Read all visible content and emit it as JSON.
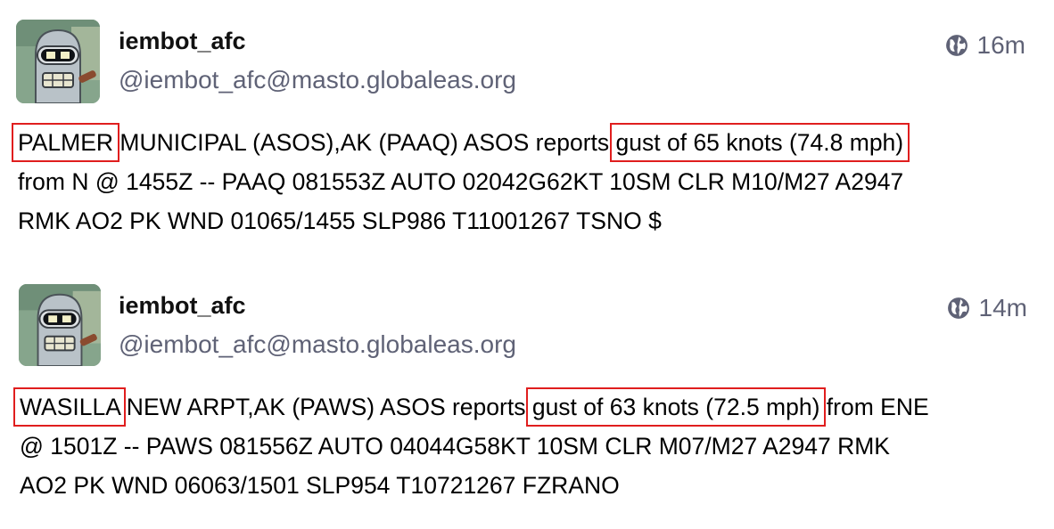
{
  "posts": [
    {
      "display_name": "iembot_afc",
      "handle": "@iembot_afc@masto.globaleas.org",
      "visibility_icon": "globe-icon",
      "timestamp": "16m",
      "content": {
        "line1_hl_station": "PALMER",
        "line1_mid": " MUNICIPAL (ASOS),AK (PAAQ) ASOS reports ",
        "line1_hl_gust": "gust of 65 knots (74.8 mph)",
        "line2": "from N @ 1455Z -- PAAQ 081553Z AUTO 02042G62KT 10SM CLR M10/M27 A2947",
        "line3": "RMK AO2 PK WND 01065/1455 SLP986 T11001267 TSNO $"
      }
    },
    {
      "display_name": "iembot_afc",
      "handle": "@iembot_afc@masto.globaleas.org",
      "visibility_icon": "globe-icon",
      "timestamp": "14m",
      "content": {
        "line1_hl_station": "WASILLA",
        "line1_mid": " NEW ARPT,AK (PAWS) ASOS reports ",
        "line1_hl_gust": "gust of 63 knots (72.5 mph)",
        "line1_tail": " from ENE",
        "line2": "@ 1501Z -- PAWS 081556Z AUTO 04044G58KT 10SM CLR M07/M27 A2947 RMK",
        "line3": "AO2 PK WND 06063/1501 SLP954 T10721267 FZRANO"
      }
    }
  ],
  "colors": {
    "highlight_box": "#e01e1e",
    "secondary_text": "#5f6276"
  }
}
